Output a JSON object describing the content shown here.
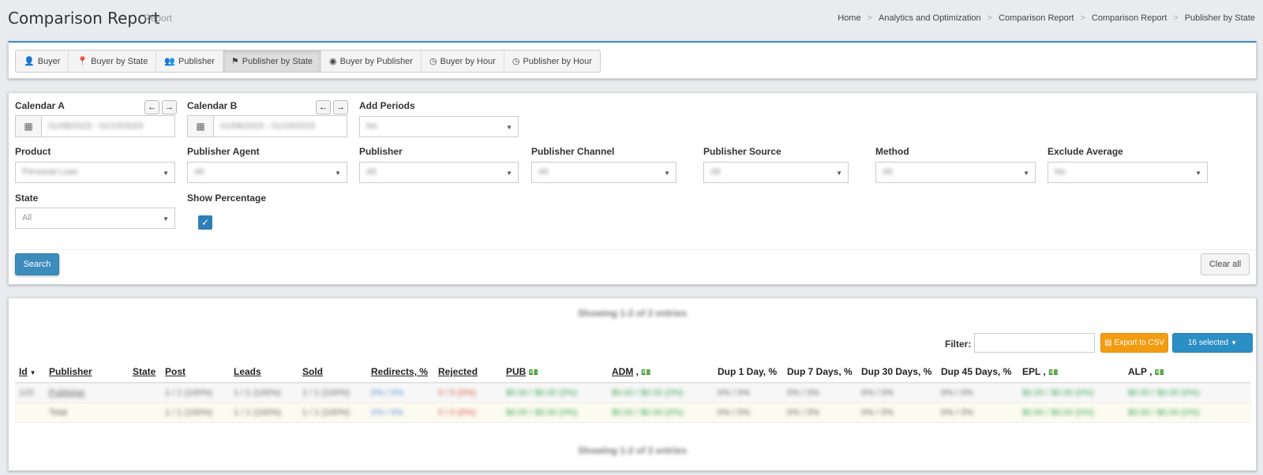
{
  "header": {
    "title": "Comparison Report",
    "subtitle": "Report",
    "breadcrumb": [
      "Home",
      "Analytics and Optimization",
      "Comparison Report",
      "Comparison Report",
      "Publisher by State"
    ],
    "separator": ">"
  },
  "tabs": [
    {
      "label": "Buyer",
      "icon": "user-icon",
      "glyph": "👤"
    },
    {
      "label": "Buyer by State",
      "icon": "map-pin-icon",
      "glyph": "📍"
    },
    {
      "label": "Publisher",
      "icon": "users-icon",
      "glyph": "👥"
    },
    {
      "label": "Publisher by State",
      "icon": "signpost-icon",
      "glyph": "⚑"
    },
    {
      "label": "Buyer by Publisher",
      "icon": "user-circle-icon",
      "glyph": "◉"
    },
    {
      "label": "Buyer by Hour",
      "icon": "clock-icon",
      "glyph": "◷"
    },
    {
      "label": "Publisher by Hour",
      "icon": "clock-icon",
      "glyph": "◷"
    }
  ],
  "filters": {
    "calendar_a": {
      "label": "Calendar A",
      "value": "01/08/2023 - 01/15/2023"
    },
    "calendar_b": {
      "label": "Calendar B",
      "value": "01/08/2023 - 01/15/2023"
    },
    "add_periods": {
      "label": "Add Periods",
      "value": "No"
    },
    "product": {
      "label": "Product",
      "value": "Personal Loan"
    },
    "publisher_agent": {
      "label": "Publisher Agent",
      "value": "All"
    },
    "publisher": {
      "label": "Publisher",
      "value": "All"
    },
    "publisher_channel": {
      "label": "Publisher Channel",
      "value": "All"
    },
    "publisher_source": {
      "label": "Publisher Source",
      "value": "All"
    },
    "method": {
      "label": "Method",
      "value": "All"
    },
    "exclude_average": {
      "label": "Exclude Average",
      "value": "No"
    },
    "state": {
      "label": "State",
      "value": "All"
    },
    "show_percentage": {
      "label": "Show Percentage",
      "checked": true
    }
  },
  "buttons": {
    "search": "Search",
    "clear_all": "Clear all",
    "export_csv": "Export to CSV",
    "selected": "16 selected",
    "filter_label": "Filter:"
  },
  "table": {
    "info_top": "Showing 1-2 of 2 entries",
    "info_bottom": "Showing 1-2 of 2 entries",
    "columns": [
      "Id",
      "Publisher",
      "State",
      "Post",
      "Leads",
      "Sold",
      "Redirects, %",
      "Rejected",
      "PUB",
      "ADM",
      "Dup 1 Day, %",
      "Dup 7 Days, %",
      "Dup 30 Days, %",
      "Dup 45 Days, %",
      "EPL",
      "ALP"
    ],
    "rows": [
      {
        "id": "123",
        "publisher": "Publisher",
        "state": "",
        "post": "1 / 1 (100%)",
        "leads": "1 / 1 (100%)",
        "sold": "1 / 1 (100%)",
        "redirects": "0% / 0%",
        "rejected": "0 / 0 (0%)",
        "pub": "$0.00 / $0.00 (0%)",
        "adm": "$0.00 / $0.00 (0%)",
        "dup1": "0% / 0%",
        "dup7": "0% / 0%",
        "dup30": "0% / 0%",
        "dup45": "0% / 0%",
        "epl": "$0.00 / $0.00 (0%)",
        "alp": "$0.00 / $0.00 (0%)"
      },
      {
        "id": "",
        "publisher": "Total",
        "state": "",
        "post": "1 / 1 (100%)",
        "leads": "1 / 1 (100%)",
        "sold": "1 / 1 (100%)",
        "redirects": "0% / 0%",
        "rejected": "0 / 0 (0%)",
        "pub": "$0.00 / $0.00 (0%)",
        "adm": "$0.00 / $0.00 (0%)",
        "dup1": "0% / 0%",
        "dup7": "0% / 0%",
        "dup30": "0% / 0%",
        "dup45": "0% / 0%",
        "epl": "$0.00 / $0.00 (0%)",
        "alp": "$0.00 / $0.00 (0%)"
      }
    ]
  },
  "colors": {
    "primary": "#3c8dbc",
    "warning": "#f39c12",
    "background": "#e9ebee"
  }
}
